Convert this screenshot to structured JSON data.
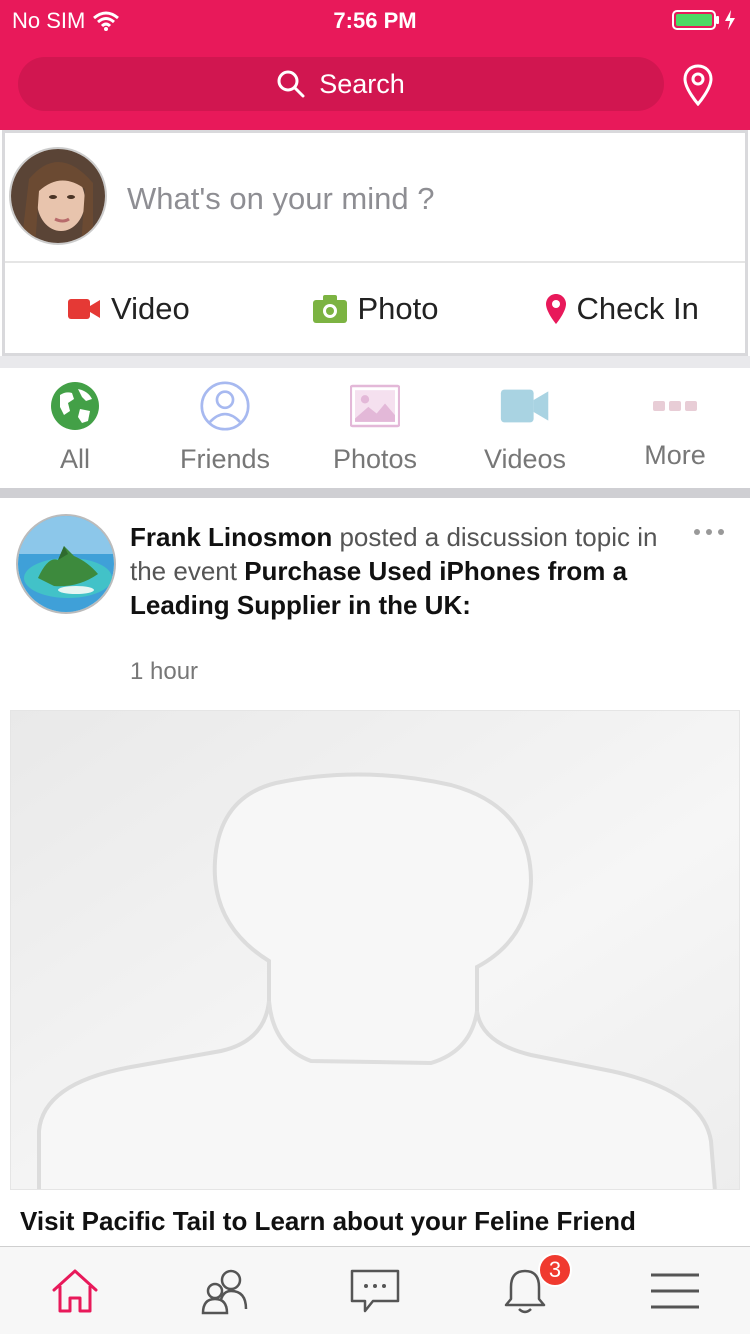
{
  "status_bar": {
    "carrier": "No SIM",
    "time": "7:56 PM"
  },
  "header": {
    "search_label": "Search"
  },
  "composer": {
    "prompt": "What's on your mind ?",
    "actions": [
      {
        "label": "Video",
        "icon": "video-camera-icon",
        "color": "#e53935"
      },
      {
        "label": "Photo",
        "icon": "camera-icon",
        "color": "#7cb342"
      },
      {
        "label": "Check In",
        "icon": "map-pin-icon",
        "color": "#e8195a"
      }
    ]
  },
  "categories": [
    {
      "label": "All",
      "icon": "globe-icon"
    },
    {
      "label": "Friends",
      "icon": "user-icon"
    },
    {
      "label": "Photos",
      "icon": "image-icon"
    },
    {
      "label": "Videos",
      "icon": "video-icon"
    },
    {
      "label": "More",
      "icon": "more-icon"
    }
  ],
  "post": {
    "author": "Frank Linosmon",
    "action_text": " posted a discussion topic in the event ",
    "event_title": "Purchase Used iPhones from a Leading Supplier in the UK:",
    "time": "1 hour",
    "link_title": "Visit Pacific Tail to Learn about your Feline Friend"
  },
  "tabbar": {
    "tabs": [
      {
        "name": "home",
        "icon": "home-icon",
        "active": true
      },
      {
        "name": "friends",
        "icon": "people-icon"
      },
      {
        "name": "messages",
        "icon": "chat-icon"
      },
      {
        "name": "notifications",
        "icon": "bell-icon",
        "badge": "3"
      },
      {
        "name": "menu",
        "icon": "hamburger-icon"
      }
    ]
  },
  "colors": {
    "brand": "#e8195a",
    "badge": "#f03a2f"
  }
}
